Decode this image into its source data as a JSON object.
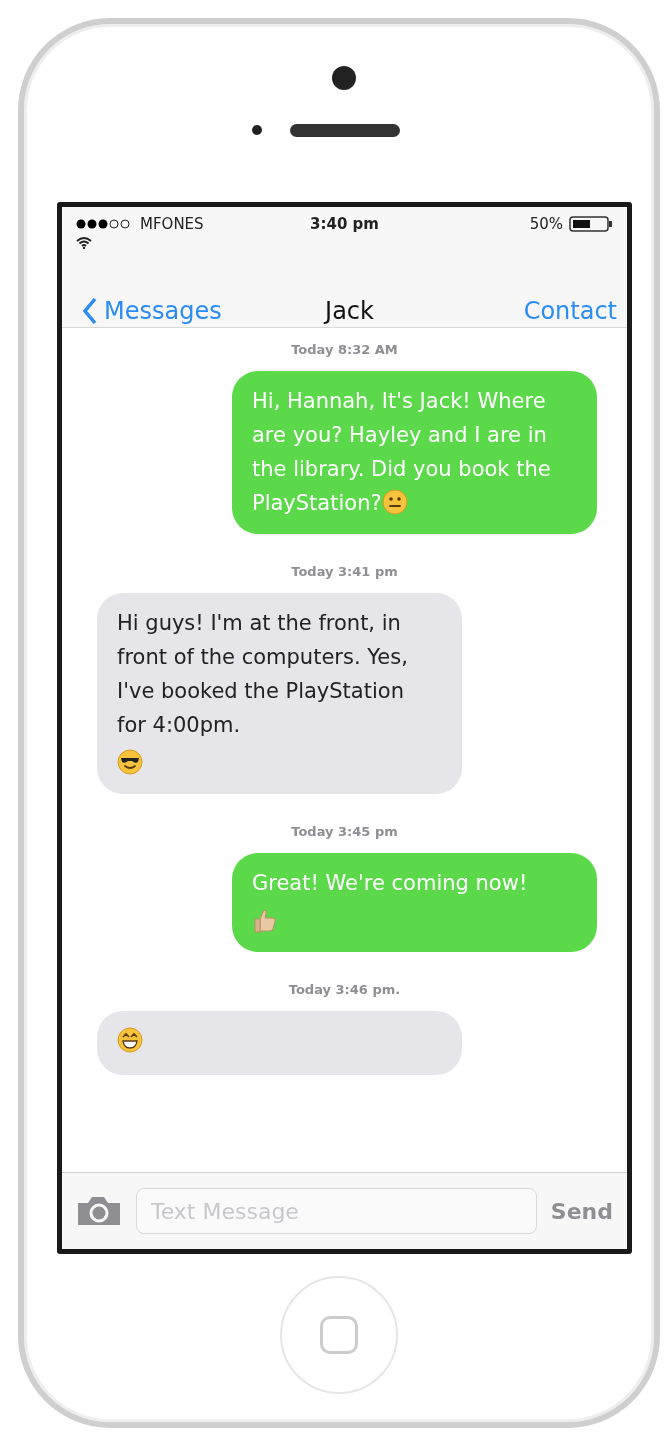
{
  "status_bar": {
    "carrier": "MFONES",
    "time": "3:40 pm",
    "battery": "50%"
  },
  "nav_bar": {
    "back": "Messages",
    "title": "Jack",
    "action": "Contact"
  },
  "messages": [
    {
      "kind": "sent",
      "time": "Today 8:32 AM",
      "text": "Hi, Hannah, It's Jack! Where are you? Hayley and I are in the library. Did you book the PlayStation?",
      "emoji": {
        "kind": "neutral",
        "new_line": false
      }
    },
    {
      "kind": "received",
      "time": "Today 3:41 pm",
      "text": "Hi guys! I'm at the front, in front of the computers. Yes, I've booked the PlayStation for 4:00pm.",
      "emoji": {
        "kind": "cool",
        "new_line": true
      }
    },
    {
      "kind": "sent",
      "time": "Today 3:45 pm",
      "text": "Great! We're coming now!",
      "emoji": {
        "kind": "thumbs_up",
        "new_line": true
      }
    },
    {
      "kind": "received",
      "time": "Today 3:46 pm.",
      "emoji": {
        "kind": "grin",
        "new_line": false
      }
    }
  ],
  "composer": {
    "placeholder": "Text Message",
    "send": "Send"
  }
}
